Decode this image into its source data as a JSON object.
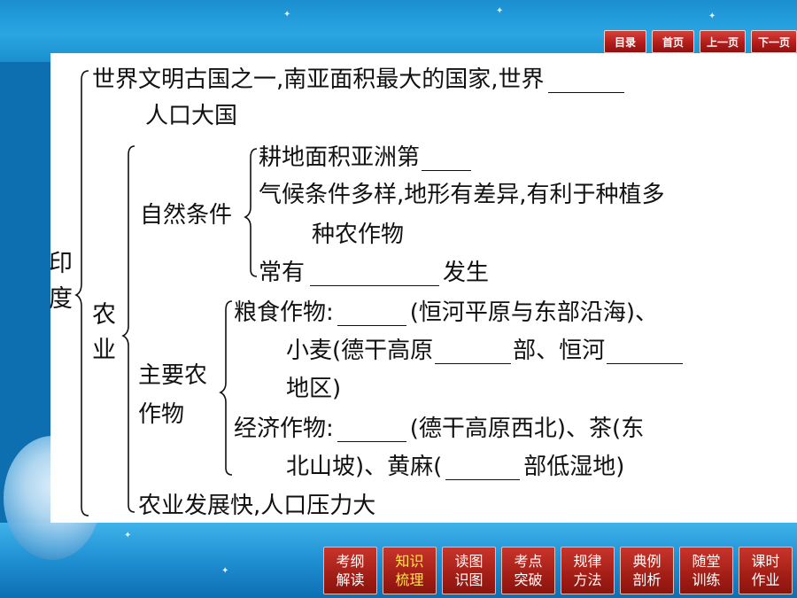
{
  "nav": {
    "contents": "目录",
    "home": "首页",
    "prev": "上一页",
    "next": "下一页"
  },
  "content": {
    "root": "印\n度",
    "line1a": "世界文明古国之一,南亚面积最大的国家,世界",
    "line1b": "人口大国",
    "agri": "农\n业",
    "natural": "自然条件",
    "nat1": "耕地面积亚洲第",
    "nat2a": "气候条件多样,地形有差异,有利于种植多",
    "nat2b": "种农作物",
    "nat3a": "常有",
    "nat3b": "发生",
    "crops": "主要农\n作物",
    "grain1a": "粮食作物:",
    "grain1b": "(恒河平原与东部沿海)、",
    "grain2a": "小麦(德干高原",
    "grain2b": "部、恒河",
    "grain3": "地区)",
    "econ1a": "经济作物:",
    "econ1b": "(德干高原西北)、茶(东",
    "econ2a": "北山坡)、黄麻(",
    "econ2b": "部低湿地)",
    "last": "农业发展快,人口压力大"
  },
  "tabs": [
    {
      "l1": "考纲",
      "l2": "解读",
      "active": false
    },
    {
      "l1": "知识",
      "l2": "梳理",
      "active": true
    },
    {
      "l1": "读图",
      "l2": "识图",
      "active": false
    },
    {
      "l1": "考点",
      "l2": "突破",
      "active": false
    },
    {
      "l1": "规律",
      "l2": "方法",
      "active": false
    },
    {
      "l1": "典例",
      "l2": "剖析",
      "active": false
    },
    {
      "l1": "随堂",
      "l2": "训练",
      "active": false
    },
    {
      "l1": "课时",
      "l2": "作业",
      "active": false
    }
  ]
}
